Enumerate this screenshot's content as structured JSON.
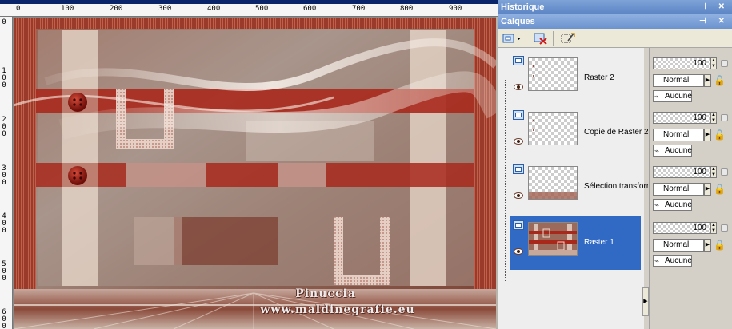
{
  "rulers": {
    "horizontal": [
      "0",
      "100",
      "200",
      "300",
      "400",
      "500",
      "600",
      "700",
      "800",
      "900"
    ],
    "vertical": [
      "0",
      "1\n0\n0",
      "2\n0\n0",
      "3\n0\n0",
      "4\n0\n0",
      "5\n0\n0",
      "6\n0\n0"
    ]
  },
  "canvas": {
    "watermark_line1": "Pinuccia",
    "watermark_line2": "www.maldinegrafie.eu"
  },
  "panels": {
    "history_title": "Historique",
    "layers_title": "Calques",
    "titlebar_icons": "⊣ ✕"
  },
  "toolbar": {
    "new_layer_icon": "new-raster-layer-icon",
    "delete_icon": "delete-layer-icon",
    "edit_selection_icon": "edit-selection-icon"
  },
  "layers": [
    {
      "name": "Raster 2",
      "opacity": "100",
      "blend": "Normal",
      "mask": "Aucune",
      "selected": false
    },
    {
      "name": "Copie de Raster 2",
      "opacity": "100",
      "blend": "Normal",
      "mask": "Aucune",
      "selected": false
    },
    {
      "name": "Sélection transformée",
      "opacity": "100",
      "blend": "Normal",
      "mask": "Aucune",
      "selected": false
    },
    {
      "name": "Raster 1",
      "opacity": "100",
      "blend": "Normal",
      "mask": "Aucune",
      "selected": true
    }
  ],
  "colors": {
    "selection": "#316ac5",
    "panel_title": "#6c93cf",
    "art_red": "#a8291c",
    "art_cream": "#e9ddd0"
  }
}
